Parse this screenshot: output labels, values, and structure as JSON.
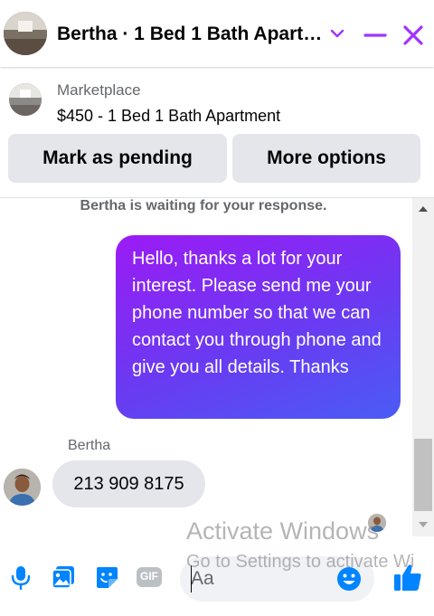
{
  "header": {
    "title": "Bertha · 1 Bed 1 Bath Apart…",
    "accent": "#a033ff"
  },
  "marketplace": {
    "label": "Marketplace",
    "listing": "$450 - 1 Bed 1 Bath Apartment",
    "pending_button": "Mark as pending",
    "more_button": "More options"
  },
  "conversation": {
    "waiting_text": "Bertha is waiting for your response.",
    "outgoing_message": "Hello, thanks a lot for your interest. Please send me your phone number so that we can contact you through phone and give you all details. Thanks",
    "sender_name": "Bertha",
    "incoming_message": "213 909 8175"
  },
  "composer": {
    "placeholder": "Aa",
    "icons": [
      "microphone-icon",
      "photo-icon",
      "sticker-icon",
      "gif-icon",
      "emoji-icon",
      "like-icon"
    ],
    "gif_label": "GIF",
    "icon_color": "#0084ff"
  },
  "watermark": {
    "title": "Activate Windows",
    "subtitle": "Go to Settings to activate Wi"
  }
}
